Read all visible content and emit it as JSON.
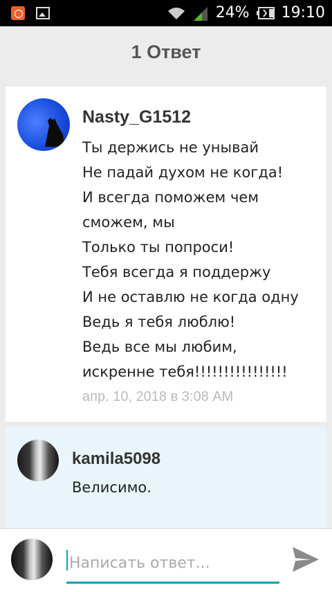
{
  "status_bar": {
    "battery": "24%",
    "time": "19:10"
  },
  "title": "1 Ответ",
  "post": {
    "author": "Nasty_G1512",
    "lines": [
      "Ты держись не унывай",
      "Не падай духом не когда!",
      "И всегда поможем чем",
      "сможем, мы",
      "Только ты попроси!",
      "Тебя всегда я поддержу",
      "И не оставлю не когда одну",
      "Ведь я тебя люблю!",
      "Ведь все мы любим,",
      "искренне тебя!!!!!!!!!!!!!!!!"
    ],
    "timestamp": "апр. 10, 2018 в 3:08 AM"
  },
  "reply": {
    "author": "kamila5098",
    "text": "Велисимо."
  },
  "composer": {
    "placeholder": "Написать ответ..."
  },
  "colors": {
    "accent": "#0fa0b0",
    "reply_bg": "#e9f5fb",
    "page_bg": "#ececec"
  }
}
